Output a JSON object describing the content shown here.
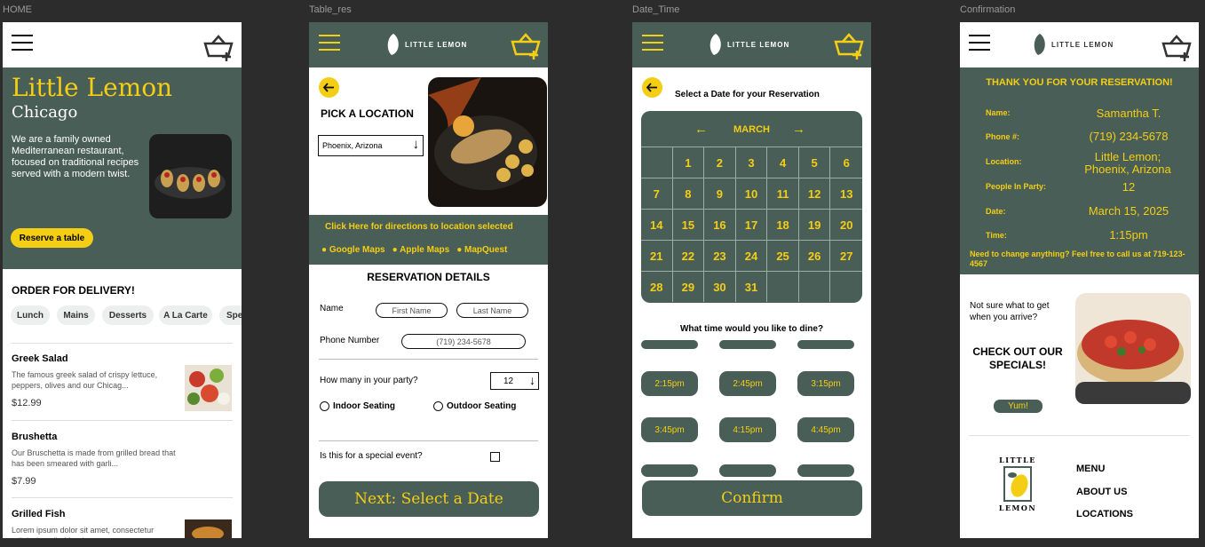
{
  "frames": {
    "home": "HOME",
    "table": "Table_res",
    "date": "Date_Time",
    "confirm": "Confirmation"
  },
  "home": {
    "title": "Little Lemon",
    "city": "Chicago",
    "description": "We are a family owned Mediterranean restaurant, focused on traditional recipes served with a modern twist.",
    "reserve_label": "Reserve a table",
    "delivery_heading": "ORDER FOR DELIVERY!",
    "categories": [
      "Lunch",
      "Mains",
      "Desserts",
      "A La Carte",
      "Specials"
    ],
    "menu": [
      {
        "name": "Greek Salad",
        "desc": "The famous greek salad of crispy lettuce, peppers, olives and our Chicag...",
        "price": "$12.99"
      },
      {
        "name": "Brushetta",
        "desc": "Our Bruschetta is made from grilled bread that has been smeared with garli...",
        "price": "$7.99"
      },
      {
        "name": "Grilled Fish",
        "desc": "Lorem ipsum dolor sit amet, consectetur adipiscing elit. Mauris ac...",
        "price": ""
      }
    ]
  },
  "logo_text": "LITTLE LEMON",
  "table": {
    "pick_location": "PICK A LOCATION",
    "location_value": "Phoenix, Arizona",
    "directions": "Click Here for directions to location selected",
    "maps": [
      "Google Maps",
      "Apple Maps",
      "MapQuest"
    ],
    "details_heading": "RESERVATION DETAILS",
    "name_label": "Name",
    "first_name_placeholder": "First Name",
    "last_name_placeholder": "Last Name",
    "phone_label": "Phone Number",
    "phone_value": "(719) 234-5678",
    "party_label": "How many in your party?",
    "party_value": "12",
    "indoor": "Indoor Seating",
    "outdoor": "Outdoor Seating",
    "special_event": "Is this for a special event?",
    "next_label": "Next: Select a Date"
  },
  "date": {
    "heading": "Select a Date for your Reservation",
    "month": "MARCH",
    "days": [
      "",
      "1",
      "2",
      "3",
      "4",
      "5",
      "6",
      "7",
      "8",
      "9",
      "10",
      "11",
      "12",
      "13",
      "14",
      "15",
      "16",
      "17",
      "18",
      "19",
      "20",
      "21",
      "22",
      "23",
      "24",
      "25",
      "26",
      "27",
      "28",
      "29",
      "30",
      "31",
      "",
      "",
      ""
    ],
    "time_question": "What time would you like to dine?",
    "times": [
      "2:15pm",
      "2:45pm",
      "3:15pm",
      "3:45pm",
      "4:15pm",
      "4:45pm"
    ],
    "confirm_label": "Confirm"
  },
  "confirm": {
    "thanks": "THANK YOU FOR YOUR RESERVATION!",
    "rows": [
      {
        "label": "Name:",
        "value": "Samantha T."
      },
      {
        "label": "Phone #:",
        "value": "(719) 234-5678"
      },
      {
        "label": "Location:",
        "value": "Little Lemon;\nPhoenix, Arizona"
      },
      {
        "label": "People In Party:",
        "value": "12"
      },
      {
        "label": "Date:",
        "value": "March 15, 2025"
      },
      {
        "label": "Time:",
        "value": "1:15pm"
      }
    ],
    "change_note": "Need to change anything? Feel free to call us at 719-123-4567",
    "not_sure": "Not sure what to get when you arrive?",
    "specials": "CHECK OUT OUR SPECIALS!",
    "yum": "Yum!",
    "footer_logo_top": "LITTLE",
    "footer_logo_bottom": "LEMON",
    "footer_links": [
      "MENU",
      "ABOUT US",
      "LOCATIONS"
    ]
  },
  "colors": {
    "primary": "#495e57",
    "accent": "#f4ce14",
    "canvas": "#2c2c2c"
  }
}
